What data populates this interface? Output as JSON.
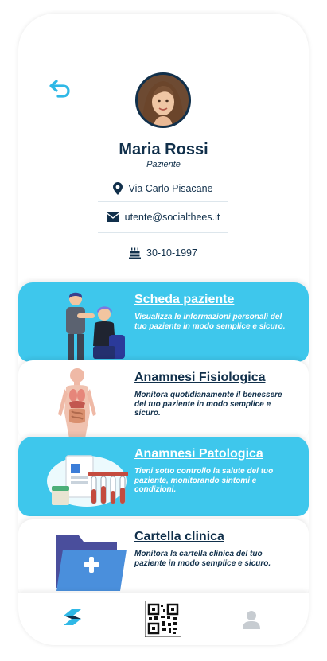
{
  "profile": {
    "name": "Maria Rossi",
    "role": "Paziente",
    "address": "Via Carlo Pisacane",
    "email": "utente@socialthees.it",
    "birth_date": "30-10-1997"
  },
  "cards": [
    {
      "title": "Scheda paziente",
      "description": "Visualizza le informazioni personali del tuo paziente in modo semplice e sicuro.",
      "style": "blue"
    },
    {
      "title": "Anamnesi Fisiologica",
      "description": "Monitora quotidianamente il benessere del tuo paziente in modo semplice e sicuro.",
      "style": "white"
    },
    {
      "title": "Anamnesi Patologica",
      "description": "Tieni sotto controllo la salute del tuo paziente, monitorando sintomi e condizioni.",
      "style": "blue"
    },
    {
      "title": "Cartella clinica",
      "description": "Monitora la cartella clinica del tuo paziente in modo semplice e sicuro.",
      "style": "white"
    }
  ],
  "colors": {
    "accent": "#3ec7ec",
    "primary_text": "#11304b",
    "icon_blue": "#2fb8e6",
    "inactive_icon": "#c7ccd1"
  },
  "icons": {
    "back": "back-arrow-icon",
    "address": "location-pin-icon",
    "email": "envelope-icon",
    "birth": "birthday-cake-icon",
    "nav_home": "app-logo-icon",
    "nav_qr": "qr-code-icon",
    "nav_profile": "user-icon"
  }
}
